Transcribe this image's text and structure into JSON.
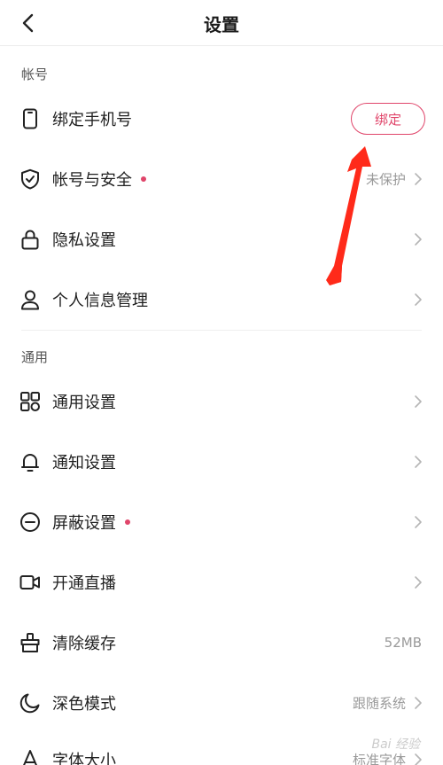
{
  "header": {
    "title": "设置"
  },
  "sections": [
    {
      "title": "帐号"
    },
    {
      "title": "通用"
    }
  ],
  "account": {
    "bind_phone": {
      "label": "绑定手机号",
      "button": "绑定"
    },
    "security": {
      "label": "帐号与安全",
      "value": "未保护"
    },
    "privacy": {
      "label": "隐私设置"
    },
    "personal_info": {
      "label": "个人信息管理"
    }
  },
  "general": {
    "general_settings": {
      "label": "通用设置"
    },
    "notifications": {
      "label": "通知设置"
    },
    "block": {
      "label": "屏蔽设置"
    },
    "live": {
      "label": "开通直播"
    },
    "cache": {
      "label": "清除缓存",
      "value": "52MB"
    },
    "dark_mode": {
      "label": "深色模式",
      "value": "跟随系统"
    },
    "font_size": {
      "label": "字体大小",
      "value": "标准字体"
    }
  },
  "watermark": "Bai 经验",
  "colors": {
    "accent": "#e0456a",
    "annotation_arrow": "#ff2a1a"
  }
}
